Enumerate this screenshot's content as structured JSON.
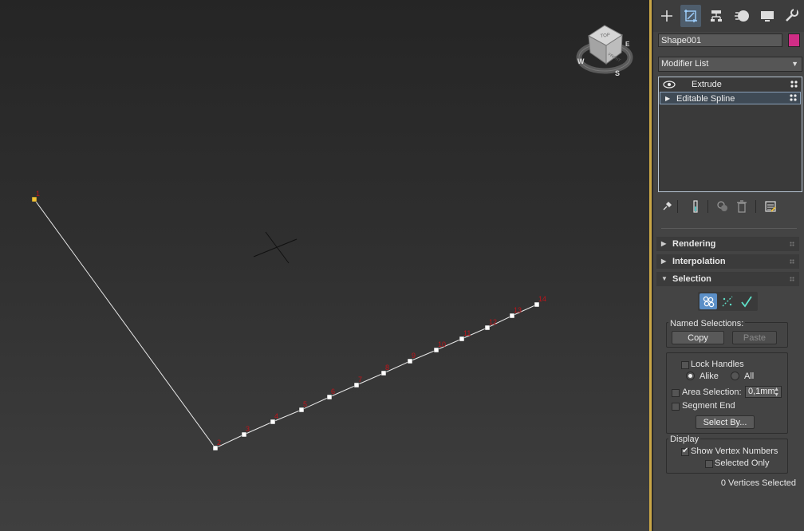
{
  "viewport": {
    "viewcube": {
      "face_top": "TOP",
      "face_front": "FRONT",
      "compass": {
        "w": "W",
        "s": "S",
        "e": "E"
      }
    },
    "spline": {
      "vertices": [
        {
          "label": "1"
        },
        {
          "label": "2"
        },
        {
          "label": "3"
        },
        {
          "label": "4"
        },
        {
          "label": "5"
        },
        {
          "label": "6"
        },
        {
          "label": "7"
        },
        {
          "label": "8"
        },
        {
          "label": "9"
        },
        {
          "label": "10"
        },
        {
          "label": "11"
        },
        {
          "label": "12"
        },
        {
          "label": "13"
        },
        {
          "label": "14"
        }
      ]
    }
  },
  "panel": {
    "tabs": [
      {
        "name": "create-tab-icon",
        "active": false
      },
      {
        "name": "modify-tab-icon",
        "active": true
      },
      {
        "name": "hierarchy-tab-icon",
        "active": false
      },
      {
        "name": "motion-tab-icon",
        "active": false
      },
      {
        "name": "display-tab-icon",
        "active": false
      },
      {
        "name": "utilities-tab-icon",
        "active": false
      }
    ],
    "object_name": "Shape001",
    "object_color": "#d02d86",
    "modifier_list_label": "Modifier List",
    "stack": [
      {
        "label": "Extrude"
      },
      {
        "label": "Editable Spline"
      }
    ],
    "rollouts": {
      "rendering": "Rendering",
      "interpolation": "Interpolation",
      "selection": "Selection"
    },
    "selection": {
      "named_selections_label": "Named Selections:",
      "copy_label": "Copy",
      "paste_label": "Paste",
      "lock_handles_label": "Lock Handles",
      "alike_label": "Alike",
      "all_label": "All",
      "area_selection_label": "Area Selection:",
      "area_selection_value": "0,1mm",
      "segment_end_label": "Segment End",
      "select_by_label": "Select By...",
      "display_label": "Display",
      "show_vertex_numbers_label": "Show Vertex Numbers",
      "selected_only_label": "Selected Only",
      "status_text": "0 Vertices Selected"
    }
  },
  "colors": {
    "accent_border": "#c9a646",
    "vertex_number": "#c0141a",
    "first_vertex": "#f2c233",
    "active_tool": "#5b8fc7"
  }
}
